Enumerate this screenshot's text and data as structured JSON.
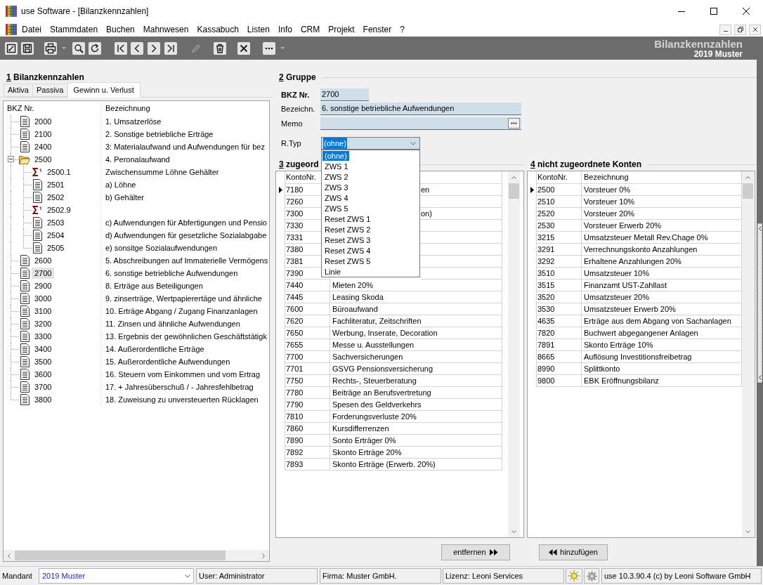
{
  "window": {
    "title": "use Software - [Bilanzkennzahlen]"
  },
  "menu": [
    "Datei",
    "Stammdaten",
    "Buchen",
    "Mahnwesen",
    "Kassabuch",
    "Listen",
    "Info",
    "CRM",
    "Projekt",
    "Fenster",
    "?"
  ],
  "toolbar": [
    {
      "kind": "edit",
      "disabled": false,
      "menu": false
    },
    {
      "kind": "save",
      "disabled": false,
      "menu": false
    },
    {
      "kind": "print",
      "disabled": false,
      "menu": true
    },
    {
      "kind": "search",
      "disabled": false,
      "menu": false
    },
    {
      "kind": "refresh",
      "disabled": false,
      "menu": false
    },
    {
      "kind": "first",
      "disabled": false,
      "menu": false
    },
    {
      "kind": "prev",
      "disabled": false,
      "menu": false
    },
    {
      "kind": "next",
      "disabled": false,
      "menu": false
    },
    {
      "kind": "last",
      "disabled": false,
      "menu": false
    },
    {
      "kind": "pencil",
      "disabled": true,
      "menu": false
    },
    {
      "kind": "delete",
      "disabled": false,
      "menu": false
    },
    {
      "kind": "cancel",
      "disabled": false,
      "menu": false
    },
    {
      "kind": "more",
      "disabled": false,
      "menu": true
    }
  ],
  "header": {
    "title": "Bilanzkennzahlen",
    "subtitle": "2019 Muster"
  },
  "bilanz": {
    "number": "1",
    "title": "Bilanzkennzahlen",
    "tabs": [
      {
        "label": "Aktiva",
        "selected": false
      },
      {
        "label": "Passiva",
        "selected": false
      },
      {
        "label": "Gewinn u. Verlust",
        "selected": true
      }
    ],
    "columns": [
      "BKZ Nr.",
      "Bezeichnung"
    ],
    "items": [
      {
        "kind": "document",
        "number": "2000",
        "label": "1. Umsatzerlöse",
        "selected": false
      },
      {
        "kind": "document",
        "number": "2100",
        "label": "2. Sonstige betriebliche Erträge",
        "selected": false
      },
      {
        "kind": "document",
        "number": "2400",
        "label": "3: Materialaufwand und Aufwendungen für bez",
        "selected": false
      },
      {
        "kind": "folder",
        "number": "2500",
        "label": "4. Peronalaufwand",
        "selected": false,
        "expanded": true,
        "children": [
          {
            "kind": "sum",
            "number": "2500.1",
            "label": "Zwischensumme Löhne Gehälter",
            "selected": false
          },
          {
            "kind": "document",
            "number": "2501",
            "label": "a) Löhne",
            "selected": false
          },
          {
            "kind": "document",
            "number": "2502",
            "label": "b) Gehälter",
            "selected": false
          },
          {
            "kind": "sum",
            "number": "2502.9",
            "selected": false
          },
          {
            "kind": "document",
            "number": "2503",
            "label": "c) Aufwendungen für Abfertigungen und Pensio",
            "selected": false
          },
          {
            "kind": "document",
            "number": "2504",
            "label": "d) Aufwendungen für gesetzliche Sozialabgabe",
            "selected": false
          },
          {
            "kind": "document",
            "number": "2505",
            "label": "e) sonsitge Sozialaufwendungen",
            "selected": false
          }
        ]
      },
      {
        "kind": "document",
        "number": "2600",
        "label": "5. Abschreibungen auf Immaterielle Vermögens",
        "selected": false
      },
      {
        "kind": "document",
        "number": "2700",
        "label": "6. sonstige betriebliche Aufwendungen",
        "selected": true
      },
      {
        "kind": "document",
        "number": "2900",
        "label": "8. Erträge aus Beteiligungen",
        "selected": false
      },
      {
        "kind": "document",
        "number": "3000",
        "label": "9. zinserträge, Wertpapierertäge und ähnliche",
        "selected": false
      },
      {
        "kind": "document",
        "number": "3100",
        "label": "10. Erträge Abgang / Zugang Finanzanlagen",
        "selected": false
      },
      {
        "kind": "document",
        "number": "3200",
        "label": "11. Zinsen und ähnliche Aufwendungen",
        "selected": false
      },
      {
        "kind": "document",
        "number": "3300",
        "label": "13. Ergebnis der gewöhnlichen Geschäftstätigk",
        "selected": false
      },
      {
        "kind": "document",
        "number": "3400",
        "label": "14. Außerordentliche Erträge",
        "selected": false
      },
      {
        "kind": "document",
        "number": "3500",
        "label": "15. Außerordentliche Aufwendungen",
        "selected": false
      },
      {
        "kind": "document",
        "number": "3600",
        "label": "16. Steuern vom Einkommen und vom Ertrag",
        "selected": false
      },
      {
        "kind": "document",
        "number": "3700",
        "label": "17. + Jahresüberschuß / - Jahresfehlbetrag",
        "selected": false
      },
      {
        "kind": "document",
        "number": "3800",
        "label": "18. Zuweisung zu unversteuerten Rücklagen",
        "selected": false
      }
    ]
  },
  "gruppe": {
    "number": "2",
    "title": "Gruppe",
    "fields": [
      {
        "kind": "number",
        "label": "BKZ Nr.",
        "value": "2700"
      },
      {
        "kind": "text",
        "label": "Bezeichn.",
        "value": "6. sonstige betriebliche Aufwendungen"
      },
      {
        "kind": "memo",
        "label": "Memo"
      }
    ],
    "rtyp": {
      "label": "R.Typ",
      "value": "(ohne)",
      "focused": true,
      "open": true,
      "options": [
        {
          "label": "(ohne)",
          "selected": true
        },
        {
          "label": "ZWS 1",
          "selected": false
        },
        {
          "label": "ZWS 2",
          "selected": false
        },
        {
          "label": "ZWS 3",
          "selected": false
        },
        {
          "label": "ZWS 4",
          "selected": false
        },
        {
          "label": "ZWS 5",
          "selected": false
        },
        {
          "label": "Reset ZWS 1",
          "selected": false
        },
        {
          "label": "Reset ZWS 2",
          "selected": false
        },
        {
          "label": "Reset ZWS 3",
          "selected": false
        },
        {
          "label": "Reset ZWS 4",
          "selected": false
        },
        {
          "label": "Reset ZWS 5",
          "selected": false
        },
        {
          "label": "Linie",
          "selected": false
        }
      ]
    }
  },
  "assigned": {
    "number": "3",
    "title": "zugeord",
    "columns": [
      "KontoNr."
    ],
    "rows": [
      {
        "konto": "7180",
        "bezeichnung": "en",
        "current": true
      },
      {
        "konto": "7260",
        "current": false
      },
      {
        "konto": "7300",
        "bezeichnung": "on)",
        "current": false
      },
      {
        "konto": "7330",
        "current": false
      },
      {
        "konto": "7331",
        "current": false
      },
      {
        "konto": "7380",
        "current": false
      },
      {
        "konto": "7381",
        "current": false
      },
      {
        "konto": "7390",
        "current": false
      },
      {
        "konto": "7440",
        "bezeichnung": "Mieten 20%",
        "current": false
      },
      {
        "konto": "7445",
        "bezeichnung": "Leasing Skoda",
        "current": false
      },
      {
        "konto": "7600",
        "bezeichnung": "Büroaufwand",
        "current": false
      },
      {
        "konto": "7620",
        "bezeichnung": "Fachliteratur, Zeitschriften",
        "current": false
      },
      {
        "konto": "7650",
        "bezeichnung": "Werbung, Inserate, Decoration",
        "current": false
      },
      {
        "konto": "7655",
        "bezeichnung": "Messe u. Ausstellungen",
        "current": false
      },
      {
        "konto": "7700",
        "bezeichnung": "Sachversicherungen",
        "current": false
      },
      {
        "konto": "7701",
        "bezeichnung": "GSVG Pensionsversicherung",
        "current": false
      },
      {
        "konto": "7750",
        "bezeichnung": "Rechts-, Steuerberatung",
        "current": false
      },
      {
        "konto": "7780",
        "bezeichnung": "Beiträge an Berufsvertretung",
        "current": false
      },
      {
        "konto": "7790",
        "bezeichnung": "Spesen des Geldverkehrs",
        "current": false
      },
      {
        "konto": "7810",
        "bezeichnung": "Forderungsverluste 20%",
        "current": false
      },
      {
        "konto": "7860",
        "bezeichnung": "Kursdifferrenzen",
        "current": false
      },
      {
        "konto": "7890",
        "bezeichnung": "Sonto Erträger 0%",
        "current": false
      },
      {
        "konto": "7892",
        "bezeichnung": "Skonto Erträge 20%",
        "current": false
      },
      {
        "konto": "7893",
        "bezeichnung": "Skonto Erträge (Erwerb. 20%)",
        "current": false
      }
    ]
  },
  "unassigned": {
    "number": "4",
    "title": "nicht zugeordnete Konten",
    "columns": [
      "KontoNr.",
      "Bezeichnung"
    ],
    "rows": [
      {
        "konto": "2500",
        "bezeichnung": "Vorsteuer 0%",
        "current": true
      },
      {
        "konto": "2510",
        "bezeichnung": "Vorsteuer 10%",
        "current": false
      },
      {
        "konto": "2520",
        "bezeichnung": "Vorsteuer 20%",
        "current": false
      },
      {
        "konto": "2530",
        "bezeichnung": "Vorsteuer Erwerb 20%",
        "current": false
      },
      {
        "konto": "3215",
        "bezeichnung": "Umsatzsteuer Metall Rev.Chage 0%",
        "current": false
      },
      {
        "konto": "3291",
        "bezeichnung": "Verrechnungskonto Anzahlungen",
        "current": false
      },
      {
        "konto": "3292",
        "bezeichnung": "Erhaltene Anzahlungen 20%",
        "current": false
      },
      {
        "konto": "3510",
        "bezeichnung": "Umsatzsteuer 10%",
        "current": false
      },
      {
        "konto": "3515",
        "bezeichnung": "Finanzamt UST-Zahllast",
        "current": false
      },
      {
        "konto": "3520",
        "bezeichnung": "Umsatzsteuer 20%",
        "current": false
      },
      {
        "konto": "3530",
        "bezeichnung": "Umsatzsteuer Erwerb 20%",
        "current": false
      },
      {
        "konto": "4635",
        "bezeichnung": "Erträge aus dem Abgang von Sachanlagen",
        "current": false
      },
      {
        "konto": "7820",
        "bezeichnung": "Buchwert abgegangener Anlagen",
        "current": false
      },
      {
        "konto": "7891",
        "bezeichnung": "Skonto Erträge 10%",
        "current": false
      },
      {
        "konto": "8665",
        "bezeichnung": "Auflösung Investitionsfreibetrag",
        "current": false
      },
      {
        "konto": "8990",
        "bezeichnung": "Splittkonto",
        "current": false
      },
      {
        "konto": "9800",
        "bezeichnung": "EBK Eröffnungsbilanz",
        "current": false
      }
    ]
  },
  "buttons": {
    "remove": "entfernen",
    "add": "hinzufügen"
  },
  "status_bar": {
    "mandant_label": "Mandant",
    "mandant": "2019 Muster",
    "user": "User: Administrator",
    "firma": "Firma: Muster GmbH.",
    "lizenz": "Lizenz: Leoni Services",
    "version": "use 10.3.90.4 (c) by Leoni Software GmbH"
  }
}
